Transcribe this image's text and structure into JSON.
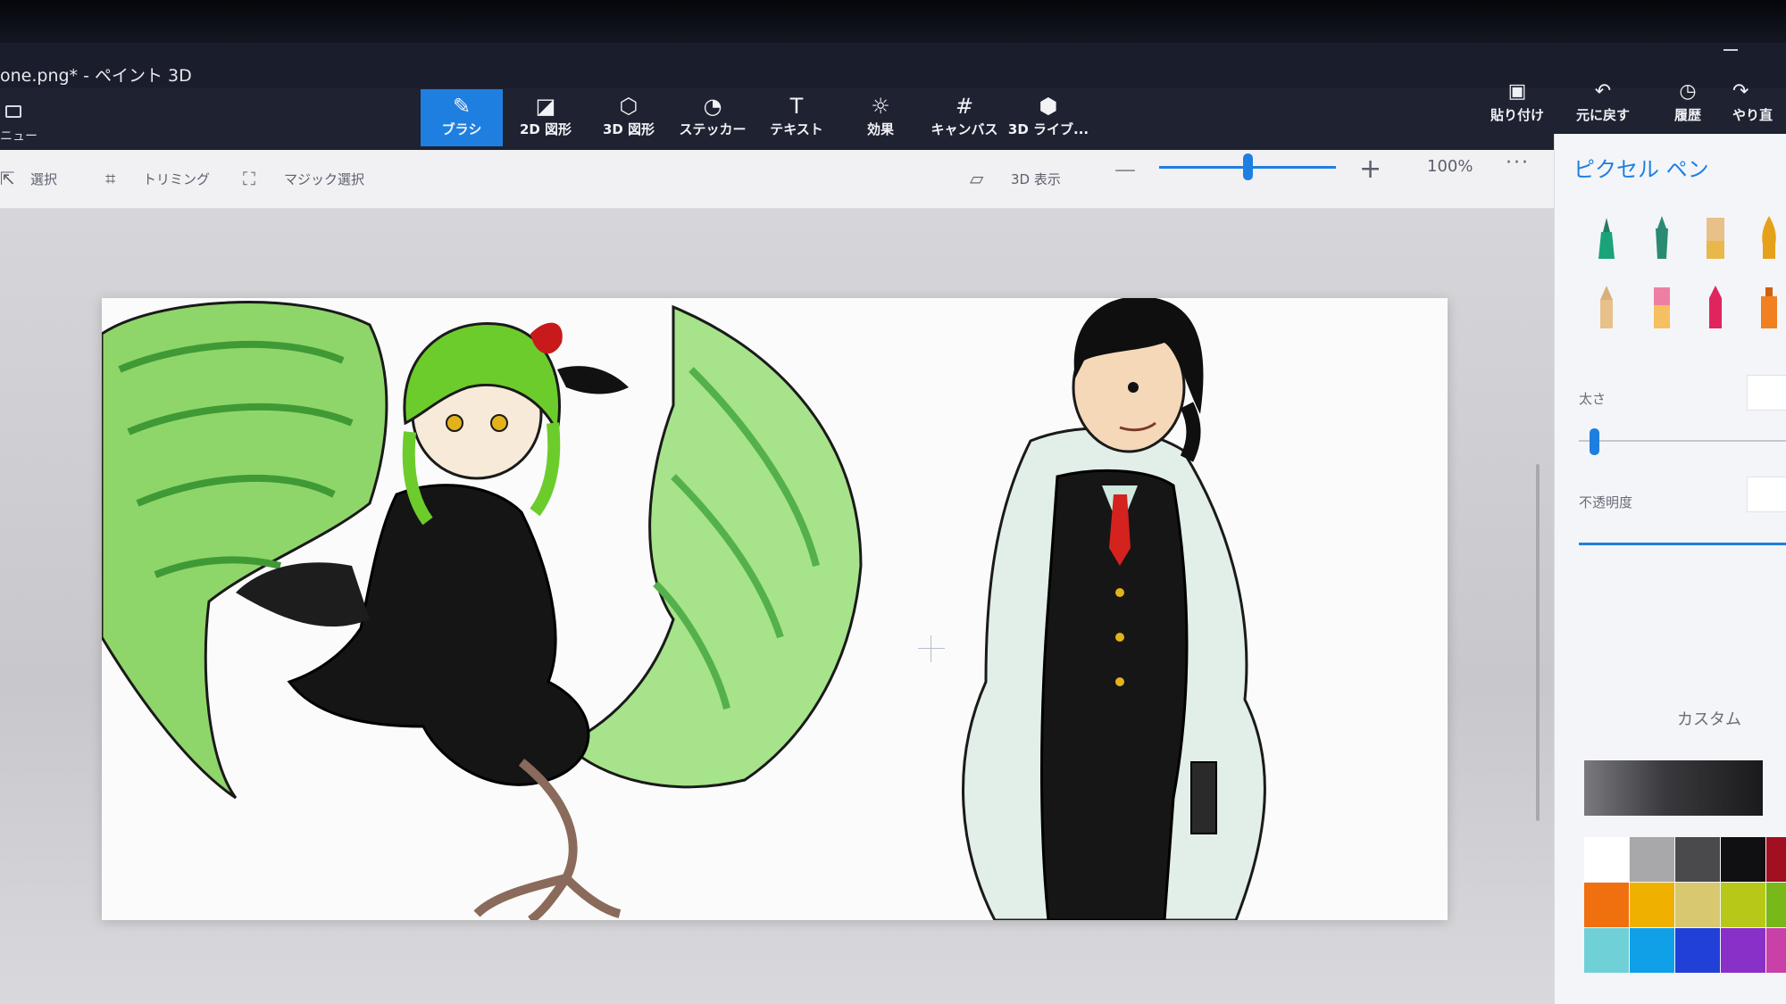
{
  "window": {
    "title": "one.png* - ペイント 3D"
  },
  "menu": {
    "label": "ニュー"
  },
  "tools": [
    {
      "label": "ブラシ",
      "icon": "brush-icon",
      "active": true
    },
    {
      "label": "2D 図形",
      "icon": "2d-shapes-icon"
    },
    {
      "label": "3D 図形",
      "icon": "3d-shapes-icon"
    },
    {
      "label": "ステッカー",
      "icon": "stickers-icon"
    },
    {
      "label": "テキスト",
      "icon": "text-icon"
    },
    {
      "label": "効果",
      "icon": "effects-icon"
    },
    {
      "label": "キャンバス",
      "icon": "canvas-icon"
    },
    {
      "label": "3D ライブ...",
      "icon": "3d-library-icon"
    }
  ],
  "right_tools": [
    {
      "label": "貼り付け",
      "icon": "paste-icon"
    },
    {
      "label": "元に戻す",
      "icon": "undo-icon"
    },
    {
      "label": "履歴",
      "icon": "history-icon"
    },
    {
      "label": "やり直",
      "icon": "redo-icon"
    }
  ],
  "subbar": {
    "select": "選択",
    "crop": "トリミング",
    "magic_select": "マジック選択",
    "view_3d": "3D 表示",
    "zoom_value": "100%",
    "zoom_level": 0.5,
    "more": "···"
  },
  "panel": {
    "title": "ピクセル ペン",
    "thickness_label": "太さ",
    "opacity_label": "不透明度",
    "custom_label": "カスタム",
    "thickness_level": 0.05,
    "opacity_level": 1.0
  },
  "pen_colors": [
    "#1aa37a",
    "#2a8a72",
    "#e9b84a",
    "#e6a11a",
    "#e8c08a",
    "#ef7fa2",
    "#e0245e",
    "#f08020"
  ],
  "palette": [
    [
      "#ffffff",
      "#a8a8aa",
      "#4a4a4c",
      "#101012",
      "#a01020"
    ],
    [
      "#f07010",
      "#f0b000",
      "#d8c870",
      "#b8c818",
      "#78b818"
    ],
    [
      "#70d0d8",
      "#10a0e8",
      "#2040d8",
      "#8830c8",
      "#c840a8"
    ]
  ],
  "colors": {
    "accent": "#1f7fe0",
    "toolbar": "#1e2231",
    "panel": "#f4f5f8"
  }
}
